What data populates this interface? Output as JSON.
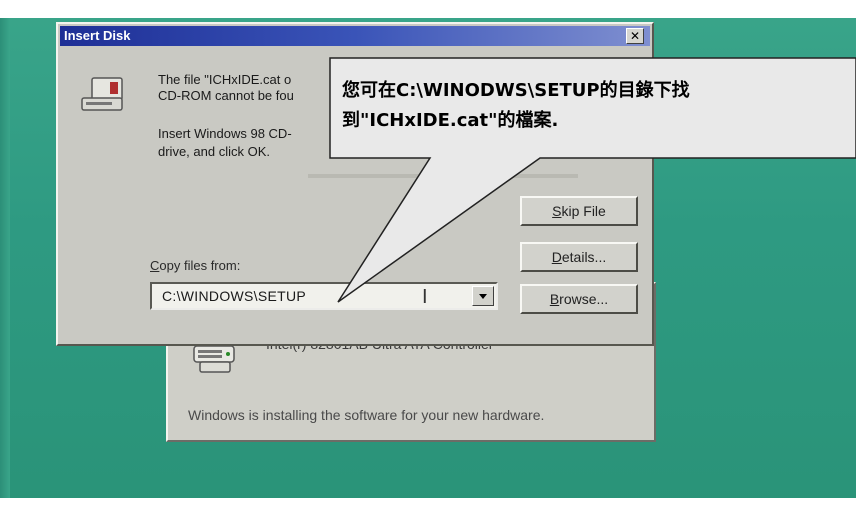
{
  "dialog": {
    "title": "Insert Disk",
    "close_glyph": "✕",
    "message_line1": "The file \"ICHxIDE.cat o",
    "message_line2": "CD-ROM cannot be fou",
    "message_line3": "Insert Windows 98 CD-",
    "message_line4": "drive, and click OK.",
    "copy_label_prefix": "C",
    "copy_label_rest": "opy files from:",
    "copy_path": "C:\\WINDOWS\\SETUP",
    "ibeam_glyph": "I",
    "buttons": {
      "skip_prefix": "S",
      "skip_rest": "kip File",
      "details_prefix": "D",
      "details_rest": "etails...",
      "browse_prefix": "B",
      "browse_rest": "rowse..."
    }
  },
  "back_dialog": {
    "device_name": "Intel(r) 82801AB Ultra ATA Controller",
    "status_text": "Windows is installing the software for your new hardware."
  },
  "callout": {
    "line1": "您可在C:\\WINODWS\\SETUP的目錄下找",
    "line2": "到\"ICHxIDE.cat\"的檔案."
  },
  "icons": {
    "disk_icon": "drive-icon",
    "device_icon": "controller-icon",
    "close_icon": "close-icon",
    "dropdown_icon": "chevron-down-icon"
  }
}
